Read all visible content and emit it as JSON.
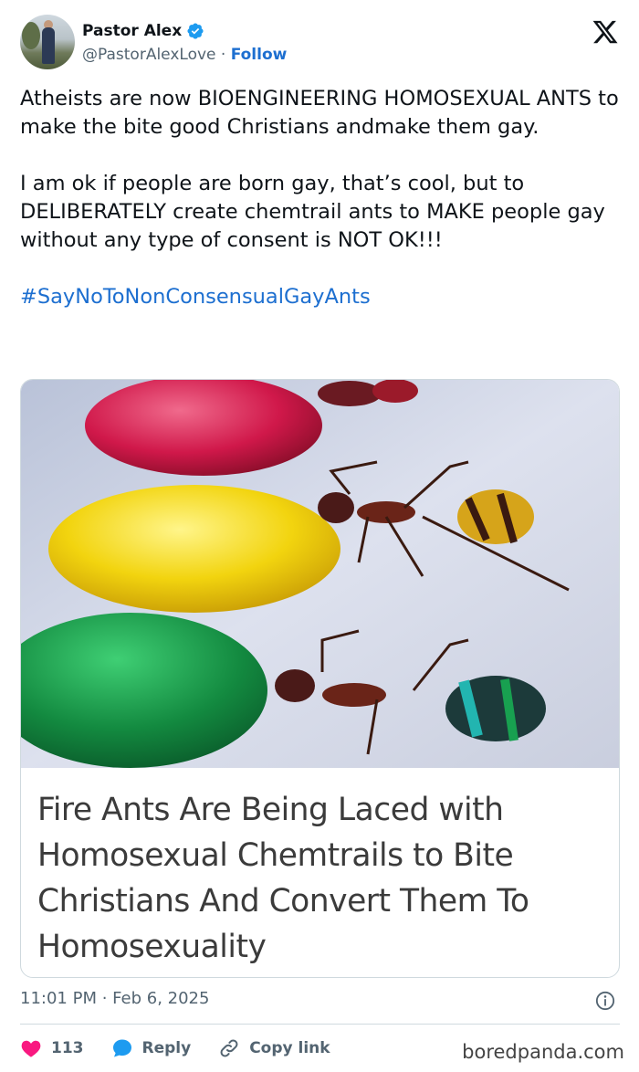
{
  "author": {
    "display_name": "Pastor Alex",
    "handle": "@PastorAlexLove",
    "separator": " · ",
    "follow_label": "Follow"
  },
  "tweet": {
    "paragraph1": "Atheists are now BIOENGINEERING HOMOSEXUAL ANTS to make the bite good Christians andmake them gay.",
    "paragraph2": "I am ok if people are born gay, that’s cool, but to DELIBERATELY create chemtrail ants to MAKE people gay without any type of consent is NOT OK!!!",
    "hashtag": "#SayNoToNonConsensualGayAnts"
  },
  "card": {
    "title": "Fire Ants Are Being Laced with Homosexual Chemtrails to Bite Christians And Convert Them To Homosexuality"
  },
  "meta": {
    "time": "11:01 PM",
    "separator": " · ",
    "date": "Feb 6, 2025"
  },
  "actions": {
    "like_count": "113",
    "reply_label": "Reply",
    "copy_link_label": "Copy link"
  },
  "watermark": "boredpanda.com",
  "colors": {
    "link_blue": "#1d6fd0",
    "like_red": "#f91880",
    "reply_blue": "#1d9bf0",
    "muted_gray": "#536471"
  }
}
